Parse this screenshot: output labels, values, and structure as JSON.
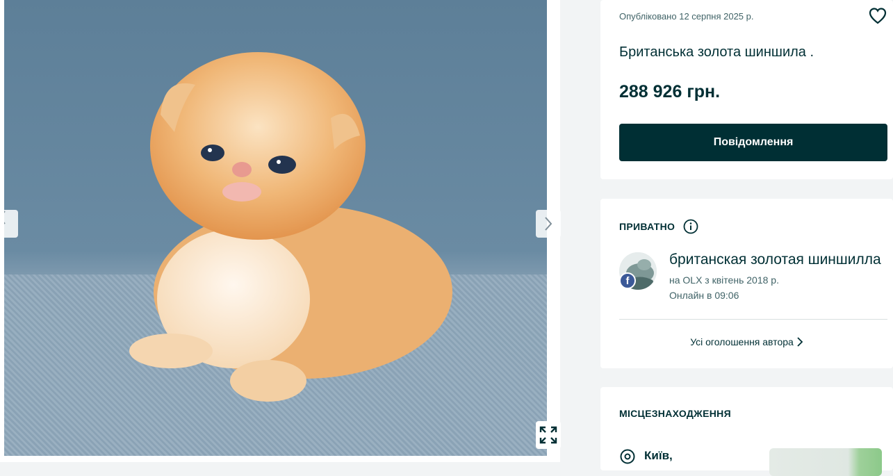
{
  "listing": {
    "posted": "Опубліковано 12 серпня 2025 р.",
    "title": "Британська золота шиншила .",
    "price": "288 926 грн.",
    "message_button": "Повідомлення"
  },
  "seller": {
    "type_label": "ПРИВАТНО",
    "name": "британская золотая шиншилла",
    "member_since": "на OLX з квітень 2018 р.",
    "online": "Онлайн в 09:06",
    "all_ads_link": "Усі оголошення автора"
  },
  "location": {
    "heading": "МІСЦЕЗНАХОДЖЕННЯ",
    "city": "Київ,"
  },
  "icons": {
    "favorite": "heart-icon",
    "info": "info-icon",
    "facebook": "facebook-icon",
    "pin": "location-pin-icon",
    "expand": "fullscreen-icon",
    "prev": "chevron-left-icon",
    "next": "chevron-right-icon"
  },
  "colors": {
    "brand_dark": "#002f34",
    "page_bg": "#f2f4f5",
    "facebook": "#3b5998"
  }
}
